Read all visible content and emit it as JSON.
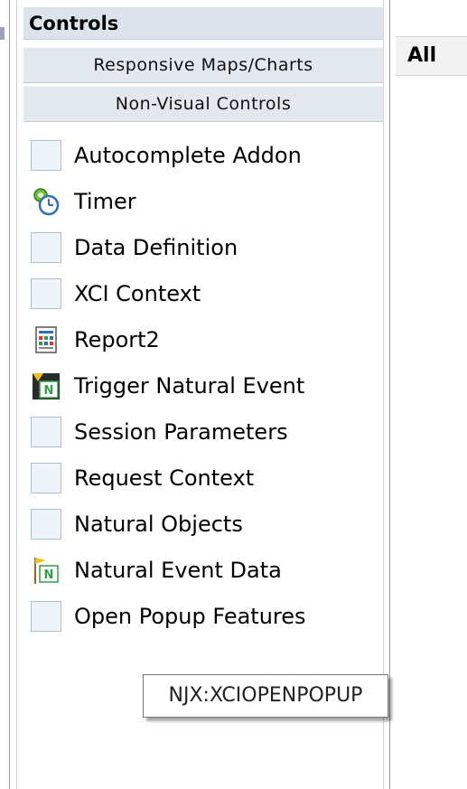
{
  "panel": {
    "title": "Controls",
    "groups": [
      {
        "label": "Responsive Maps/Charts"
      },
      {
        "label": "Non-Visual Controls"
      }
    ],
    "items": [
      {
        "label": "Autocomplete Addon",
        "icon": "blank-control-icon"
      },
      {
        "label": "Timer",
        "icon": "timer-icon"
      },
      {
        "label": "Data Definition",
        "icon": "blank-control-icon"
      },
      {
        "label": "XCI Context",
        "icon": "blank-control-icon"
      },
      {
        "label": "Report2",
        "icon": "report-icon"
      },
      {
        "label": "Trigger Natural Event",
        "icon": "natural-event-icon"
      },
      {
        "label": "Session Parameters",
        "icon": "blank-control-icon"
      },
      {
        "label": "Request Context",
        "icon": "blank-control-icon"
      },
      {
        "label": "Natural Objects",
        "icon": "blank-control-icon"
      },
      {
        "label": "Natural Event Data",
        "icon": "natural-event-data-icon"
      },
      {
        "label": "Open Popup Features",
        "icon": "blank-control-icon"
      }
    ]
  },
  "tabs": {
    "all_label": "All"
  },
  "tooltip": {
    "text": "NJX:XCIOPENPOPUP"
  },
  "colors": {
    "header_bg": "#dde3ec",
    "group_bg": "#e3e8ef",
    "icon_border": "#a9c0d6"
  }
}
